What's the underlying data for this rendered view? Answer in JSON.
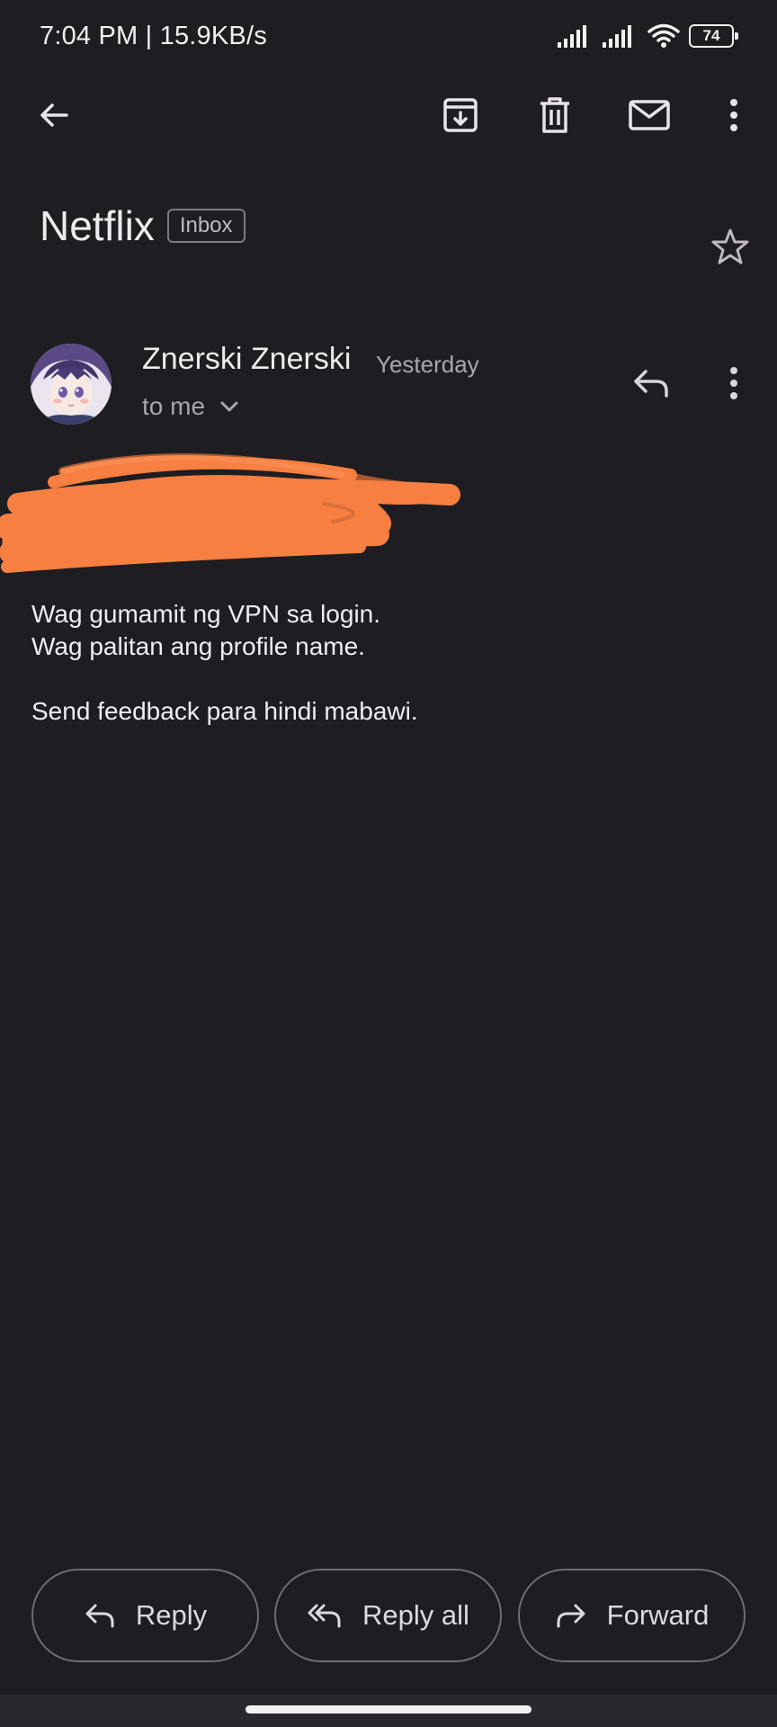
{
  "status_bar": {
    "time_and_speed": "7:04 PM | 15.9KB/s",
    "battery_level": "74"
  },
  "toolbar": {
    "back_icon": "arrow-left-icon",
    "archive_icon": "archive-icon",
    "delete_icon": "trash-icon",
    "mark_unread_icon": "mail-icon",
    "more_icon": "more-vert-icon"
  },
  "email": {
    "subject": "Netflix",
    "label": "Inbox",
    "sender_name": "Znerski Znerski",
    "time": "Yesterday",
    "recipient": "to me",
    "body_lines": [
      "Wag gumamit ng VPN sa login.",
      "Wag palitan ang profile name.",
      "Send feedback para hindi mabawi."
    ]
  },
  "actions": {
    "reply": "Reply",
    "reply_all": "Reply all",
    "forward": "Forward"
  },
  "colors": {
    "background": "#1e1d22",
    "redaction": "#f77f41",
    "text": "#efedf1",
    "muted": "#a9a7ac"
  }
}
